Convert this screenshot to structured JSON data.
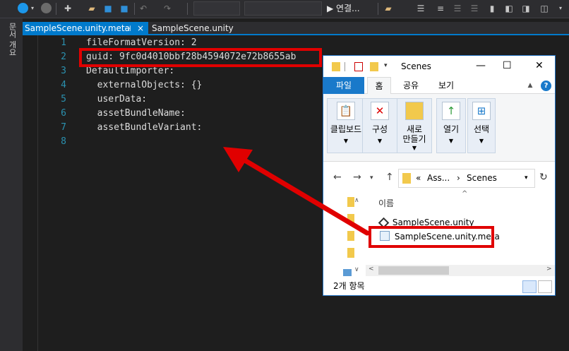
{
  "toolbar": {
    "start_label": "▶ 연결...",
    "nav_back_icon": "circle-arrow-left-icon",
    "nav_forward_icon": "circle-arrow-right-icon"
  },
  "left_strip": {
    "document_outline_label": "문서 개요"
  },
  "tabs": [
    {
      "label": "SampleScene.unity.meta",
      "active": true
    },
    {
      "label": "SampleScene.unity",
      "active": false
    }
  ],
  "tab_pin_icon": "⊣",
  "tab_close_icon": "×",
  "editor": {
    "line_numbers": [
      "1",
      "2",
      "3",
      "4",
      "5",
      "6",
      "7",
      "8"
    ],
    "lines": [
      "fileFormatVersion: 2",
      "guid: 9fc0d4010bbf28b4594072e72b8655ab",
      "DefaultImporter:",
      "  externalObjects: {}",
      "  userData:",
      "  assetBundleName:",
      "  assetBundleVariant:",
      ""
    ]
  },
  "explorer": {
    "title": "Scenes",
    "ribbon_tabs": {
      "file": "파일",
      "home": "홈",
      "share": "공유",
      "view": "보기"
    },
    "ribbon_groups": [
      {
        "label_line1": "클립보드",
        "label_line2": "",
        "icon": "clipboard-icon"
      },
      {
        "label_line1": "구성",
        "label_line2": "",
        "icon": "x-mark-icon"
      },
      {
        "label_line1": "새로",
        "label_line2": "만들기",
        "icon": "new-folder-icon"
      },
      {
        "label_line1": "열기",
        "label_line2": "",
        "icon": "open-icon"
      },
      {
        "label_line1": "선택",
        "label_line2": "",
        "icon": "select-icon"
      }
    ],
    "address": {
      "prefix": "«",
      "part1": "Ass...",
      "separator": "›",
      "part2": "Scenes"
    },
    "column_header": "이름",
    "files": [
      {
        "name": "SampleScene.unity",
        "icon": "unity-icon"
      },
      {
        "name": "SampleScene.unity.meta",
        "icon": "meta-file-icon"
      }
    ],
    "status_text": "2개 항목"
  },
  "annotation": {
    "color": "#e00000"
  }
}
